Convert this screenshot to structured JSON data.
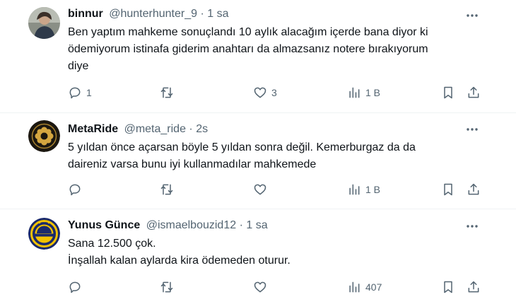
{
  "tweets": [
    {
      "name": "binnur",
      "handle": "@hunterhunter_9",
      "separator": "·",
      "time": "1 sa",
      "lines": [
        "Ben yaptım  mahkeme sonuçlandı 10 aylık alacağım içerde bana diyor ki",
        "ödemiyorum istinafa giderim anahtarı da almazsanız notere bırakıyorum",
        "diye"
      ],
      "replies": "1",
      "retweets": "",
      "likes": "3",
      "views": "1 B"
    },
    {
      "name": "MetaRide",
      "handle": "@meta_ride",
      "separator": "·",
      "time": "2s",
      "lines": [
        "5 yıldan önce açarsan böyle 5 yıldan sonra değil. Kemerburgaz da da",
        "daireniz varsa bunu iyi kullanmadılar mahkemede"
      ],
      "replies": "",
      "retweets": "",
      "likes": "",
      "views": "1 B"
    },
    {
      "name": "Yunus Günce",
      "handle": "@ismaelbouzid12",
      "separator": "·",
      "time": "1 sa",
      "lines": [
        "Sana 12.500 çok.",
        "İnşallah kalan aylarda kira ödemeden oturur."
      ],
      "replies": "",
      "retweets": "",
      "likes": "",
      "views": "407"
    }
  ],
  "colors": {
    "text": "#0f1419",
    "secondary": "#536471",
    "divider": "#eff3f4",
    "team_navy": "#1a2a6c",
    "team_yellow": "#f2c200"
  },
  "icons": [
    "more-icon",
    "reply-icon",
    "retweet-icon",
    "like-icon",
    "views-icon",
    "bookmark-icon",
    "share-icon"
  ]
}
